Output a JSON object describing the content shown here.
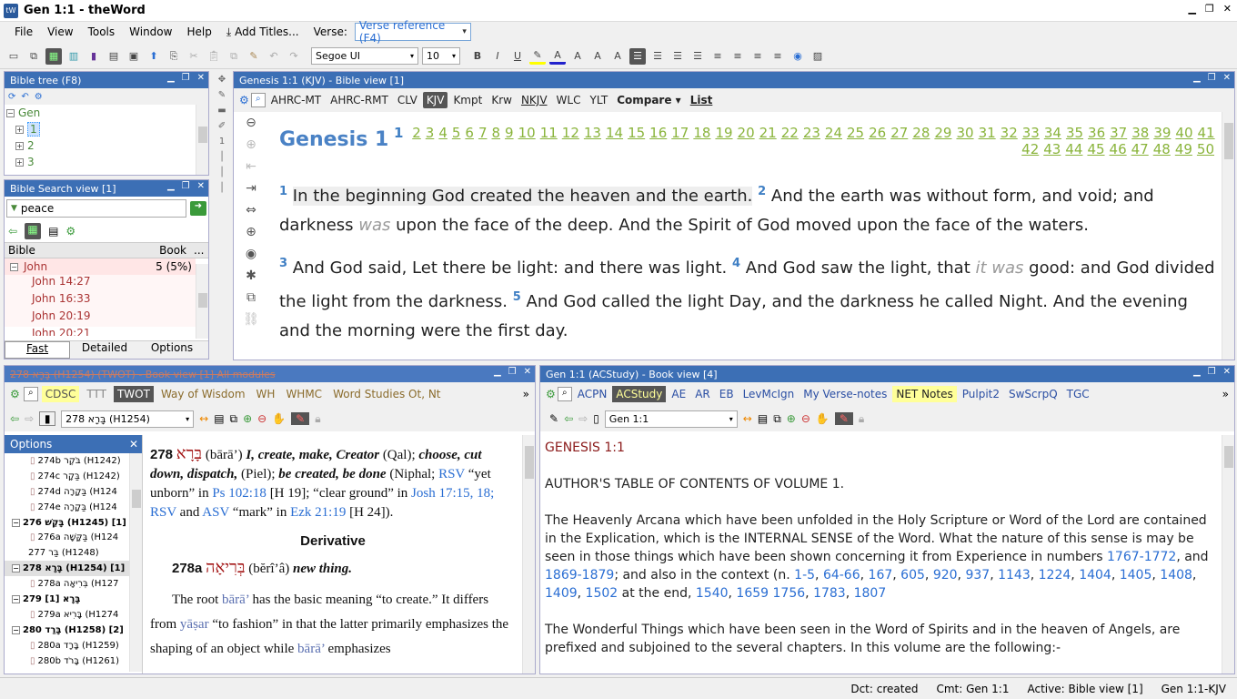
{
  "window": {
    "title": "Gen 1:1 - theWord",
    "icon": "tW"
  },
  "menu": {
    "items": [
      "File",
      "View",
      "Tools",
      "Window",
      "Help"
    ],
    "add_titles": "Add Titles...",
    "verse_label": "Verse:",
    "verse_placeholder": "Verse reference (F4)"
  },
  "toolbar": {
    "font": "Segoe UI",
    "size": "10"
  },
  "bible_tree": {
    "title": "Bible tree (F8)",
    "root": "Gen",
    "children": [
      "1",
      "2",
      "3"
    ]
  },
  "bible_search": {
    "title": "Bible Search view [1]",
    "query": "peace",
    "col_bible": "Bible",
    "col_book": "Book",
    "col_more": "...",
    "book": "John",
    "book_count": "5 (5%)",
    "results": [
      "John 14:27",
      "John 16:33",
      "John 20:19",
      "John 20:21"
    ],
    "tabs": [
      "Fast",
      "Detailed",
      "Options"
    ]
  },
  "bible_view": {
    "title": "Genesis 1:1 (KJV)  - Bible view [1]",
    "modules": [
      "AHRC-MT",
      "AHRC-RMT",
      "CLV",
      "KJV",
      "Kmpt",
      "Krw",
      "NKJV",
      "WLC",
      "YLT"
    ],
    "compare": "Compare",
    "list": "List",
    "book": "Genesis 1",
    "chapters_row1": [
      "1",
      "2",
      "3",
      "4",
      "5",
      "6",
      "7",
      "8",
      "9",
      "10",
      "11",
      "12",
      "13",
      "14",
      "15",
      "16",
      "17",
      "18",
      "19",
      "20",
      "21",
      "22",
      "23",
      "24",
      "25",
      "26",
      "27",
      "28",
      "29",
      "30",
      "31",
      "32",
      "33",
      "34",
      "35",
      "36",
      "37",
      "38",
      "39",
      "40",
      "41"
    ],
    "chapters_row2": [
      "42",
      "43",
      "44",
      "45",
      "46",
      "47",
      "48",
      "49",
      "50"
    ],
    "v1n": "1",
    "v1": "In the beginning God created the heaven and the earth.",
    "v2n": "2",
    "v2a": "And the earth was without form, and void; and darkness",
    "v2i": "was",
    "v2b": "upon the face of the deep. And the Spirit of God moved upon the face of the waters.",
    "v3n": "3",
    "v3": "And God said, Let there be light: and there was light.",
    "v4n": "4",
    "v4a": "And God saw the light, that",
    "v4i": "it was",
    "v4b": "good: and God divided",
    "v4c": "the light from the darkness.",
    "v5n": "5",
    "v5a": "And God called the light Day, and the darkness he called Night. And the evening and the",
    "v5b": "morning were the first day."
  },
  "book_view_left": {
    "title": "278 בָּרָא (H1254) (TWOT) - Book view [1] All modules",
    "tabs": [
      "CDSC",
      "TTT",
      "TWOT",
      "Way of Wisdom",
      "WH",
      "WHMC",
      "Word Studies Ot, Nt"
    ],
    "entry": "278 בָּרָא (H1254)",
    "options": "Options",
    "tree": [
      {
        "t": "274b בֹּקֶר (H1242)",
        "k": "c"
      },
      {
        "t": "274c בַּקָר (H1242)",
        "k": "c"
      },
      {
        "t": "274d בַּקָרָה (H124",
        "k": "c"
      },
      {
        "t": "274e בַּקָרָה (H124",
        "k": "c"
      },
      {
        "t": "276 בָּקַשׁ (H1245) [1]",
        "k": "p"
      },
      {
        "t": "276a בַּקָּשָׁה (H124",
        "k": "c"
      },
      {
        "t": "277 בַּר (H1248)",
        "k": "n"
      },
      {
        "t": "278 בָּרָא (H1254) [1]",
        "k": "p"
      },
      {
        "t": "278a בְּרִיאָה (H127",
        "k": "c"
      },
      {
        "t": "279 בָּרָא [1]",
        "k": "p"
      },
      {
        "t": "279a בָּרִיא (H1274",
        "k": "c"
      },
      {
        "t": "280 בָּרַד (H1258) [2]",
        "k": "p"
      },
      {
        "t": "280a בָּרָד (H1259)",
        "k": "c"
      },
      {
        "t": "280b בָּרֹד (H1261)",
        "k": "c"
      }
    ],
    "c_num": "278",
    "c_heb": "בָּרָא",
    "c_tr": "(bārā’)",
    "c_def1": "I, create, make, Creator",
    "c_qal": "(Qal);",
    "c_def2": "choose, cut down, dispatch,",
    "c_piel": "(Piel);",
    "c_def3": "be created, be done",
    "c_niph": "(Niphal;",
    "c_rsv": "RSV",
    "c_q1": "“yet unborn” in",
    "c_ps": "Ps 102:18",
    "c_h19": "[H 19]; “clear ground”",
    "c_in": "in",
    "c_josh": "Josh 17:15,",
    "c_18": "18;",
    "c_rsv2": "RSV",
    "c_and": "and",
    "c_asv": "ASV",
    "c_mark": "“mark” in",
    "c_ezk": "Ezk 21:19",
    "c_h24": "[H",
    "c_h24b": "24]).",
    "c_deriv": "Derivative",
    "c_278a": "278a",
    "c_heb2": "בְּרִיאָה",
    "c_tr2": "(bĕrî’â)",
    "c_new": "new thing.",
    "c_root1": "The root",
    "c_bara": "bārā’",
    "c_root2": "has the basic meaning “to create.” It",
    "c_diff": "differs from",
    "c_yasar": "yāṣar",
    "c_diff2": "“to fashion” in that the latter primarily",
    "c_emph": "emphasizes the shaping of an object while",
    "c_bara2": "bārā’",
    "c_emph2": "emphasizes"
  },
  "book_view_right": {
    "title": "Gen 1:1  (ACStudy) - Book view [4]",
    "tabs": [
      "ACPN",
      "ACStudy",
      "AE",
      "AR",
      "EB",
      "LevMcIgn",
      "My Verse-notes",
      "NET Notes",
      "Pulpit2",
      "SwScrpQ",
      "TGC"
    ],
    "ref": "Gen 1:1",
    "heading": "GENESIS 1:1",
    "toc": "AUTHOR'S TABLE OF CONTENTS OF VOLUME 1.",
    "p1a": "The Heavenly Arcana which have been unfolded in the Holy Scripture or Word of the Lord are contained in the",
    "p1b": "Explication, which is the INTERNAL SENSE of the Word. What the nature of this sense is may be seen in those",
    "p1c": "things which have been shown concerning it from Experience in numbers",
    "r1": "1767-1772",
    "and": ", and",
    "r2": "1869-1879",
    "p1d": "; and also in",
    "p1e": "the context (n.",
    "refs": [
      "1-5",
      "64-66",
      "167",
      "605",
      "920",
      "937",
      "1143",
      "1224",
      "1404",
      "1405",
      "1408",
      "1409",
      "1502"
    ],
    "p1f": "at the end,",
    "refs2": [
      "1540",
      "1659"
    ],
    "refs3": [
      "1756",
      "1783",
      "1807"
    ],
    "p2a": "The Wonderful Things which have been seen in the Word of Spirits and in the heaven of Angels, are prefixed",
    "p2b": "and subjoined to the several chapters. In this volume are the following:-"
  },
  "status": {
    "dct": "Dct: created",
    "cmt": "Cmt: Gen 1:1",
    "active": "Active: Bible view [1]",
    "ref": "Gen 1:1-KJV"
  },
  "colors": {
    "panel_header": "#3c6fb5",
    "link": "#2a6ed3",
    "chapter": "#8ab43c",
    "hebrew": "#a31515"
  }
}
